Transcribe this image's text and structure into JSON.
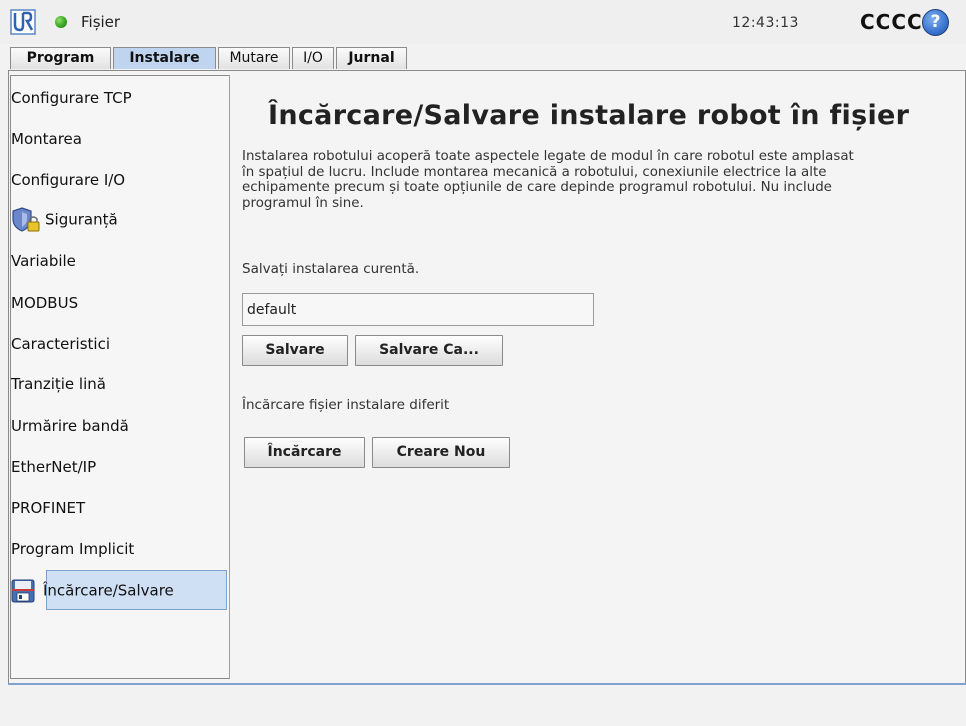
{
  "header": {
    "file_menu": "Fișier",
    "time": "12:43:13",
    "robot_name": "CCCC",
    "help_label": "?",
    "status_color": "#3aa524"
  },
  "tabs": [
    "Program",
    "Instalare",
    "Mutare",
    "I/O",
    "Jurnal"
  ],
  "sidebar": {
    "items": [
      "Configurare TCP",
      "Montarea",
      "Configurare I/O",
      "Siguranță",
      "Variabile",
      "MODBUS",
      "Caracteristici",
      "Tranziție lină",
      "Urmărire bandă",
      "EtherNet/IP",
      "PROFINET",
      "Program Implicit",
      "Încărcare/Salvare"
    ]
  },
  "main": {
    "title": "Încărcare/Salvare instalare robot în fișier",
    "description_lines": [
      "Instalarea robotului acoperă toate aspectele legate de modul în care robotul este amplasat",
      "în spațiul de lucru. Include montarea mecanică a robotului, conexiunile electrice la alte",
      "echipamente precum și toate opțiunile de care depinde programul robotului. Nu include",
      "programul în sine."
    ],
    "save_label": "Salvați instalarea curentă.",
    "filename_value": "default",
    "save_button": "Salvare",
    "save_as_button": "Salvare Ca...",
    "load_label": "Încărcare fișier instalare diferit",
    "load_button": "Încărcare",
    "new_button": "Creare Nou"
  },
  "colors": {
    "accent": "#bfd5ef",
    "selection": "#cfe0f4"
  }
}
